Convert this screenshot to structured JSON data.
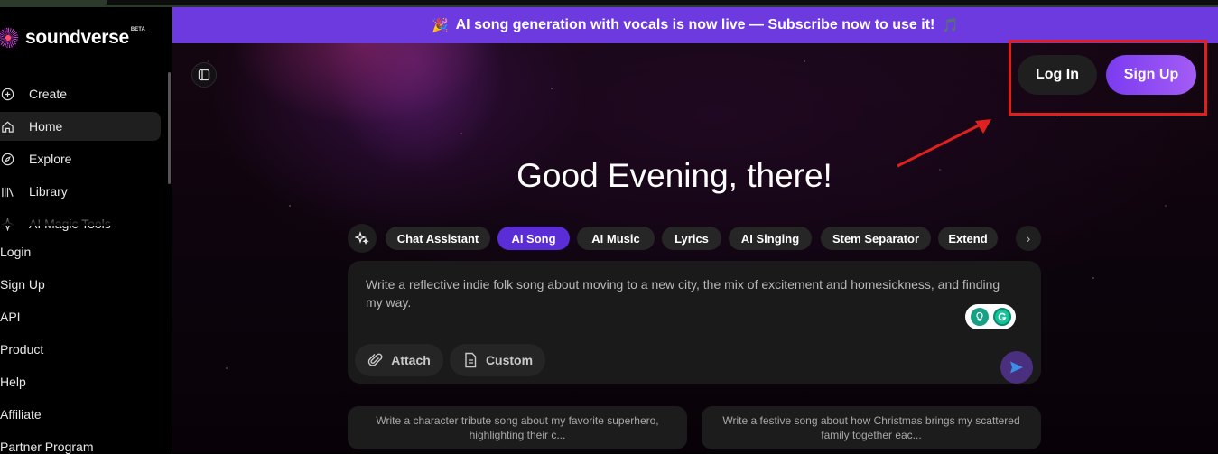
{
  "banner": {
    "emoji_left": "🎉",
    "text": "AI song generation with vocals is now live — Subscribe now to use it!",
    "emoji_right": "🎵"
  },
  "brand": {
    "name": "soundverse",
    "badge": "BETA"
  },
  "sidebar": {
    "nav": [
      {
        "label": "Create",
        "icon": "plus-circle-icon"
      },
      {
        "label": "Home",
        "icon": "home-icon",
        "active": true
      },
      {
        "label": "Explore",
        "icon": "compass-icon"
      },
      {
        "label": "Library",
        "icon": "library-icon"
      },
      {
        "label": "AI Magic Tools",
        "icon": "sparkle-icon"
      }
    ],
    "links": [
      "Login",
      "Sign Up",
      "API",
      "Product",
      "Help",
      "Affiliate",
      "Partner Program"
    ]
  },
  "header": {
    "login_label": "Log In",
    "signup_label": "Sign Up"
  },
  "greeting": "Good Evening, there!",
  "chips": {
    "items": [
      {
        "label": "Chat Assistant",
        "active": false
      },
      {
        "label": "AI Song",
        "active": true
      },
      {
        "label": "AI Music",
        "active": false
      },
      {
        "label": "Lyrics",
        "active": false
      },
      {
        "label": "AI Singing",
        "active": false
      },
      {
        "label": "Stem Separator",
        "active": false
      },
      {
        "label": "Extend",
        "active": false
      }
    ],
    "next_glyph": "›"
  },
  "prompt": {
    "text": "Write a reflective indie folk song about moving to a new city, the mix of excitement and homesickness, and finding my way.",
    "attach_label": "Attach",
    "custom_label": "Custom"
  },
  "suggestions": [
    "Write a character tribute song about my favorite superhero, highlighting their c...",
    "Write a festive song about how Christmas brings my scattered family together eac..."
  ],
  "colors": {
    "accent": "#6d3ae0",
    "chip_active": "#5b2dd6",
    "annotation": "#e0201f"
  }
}
